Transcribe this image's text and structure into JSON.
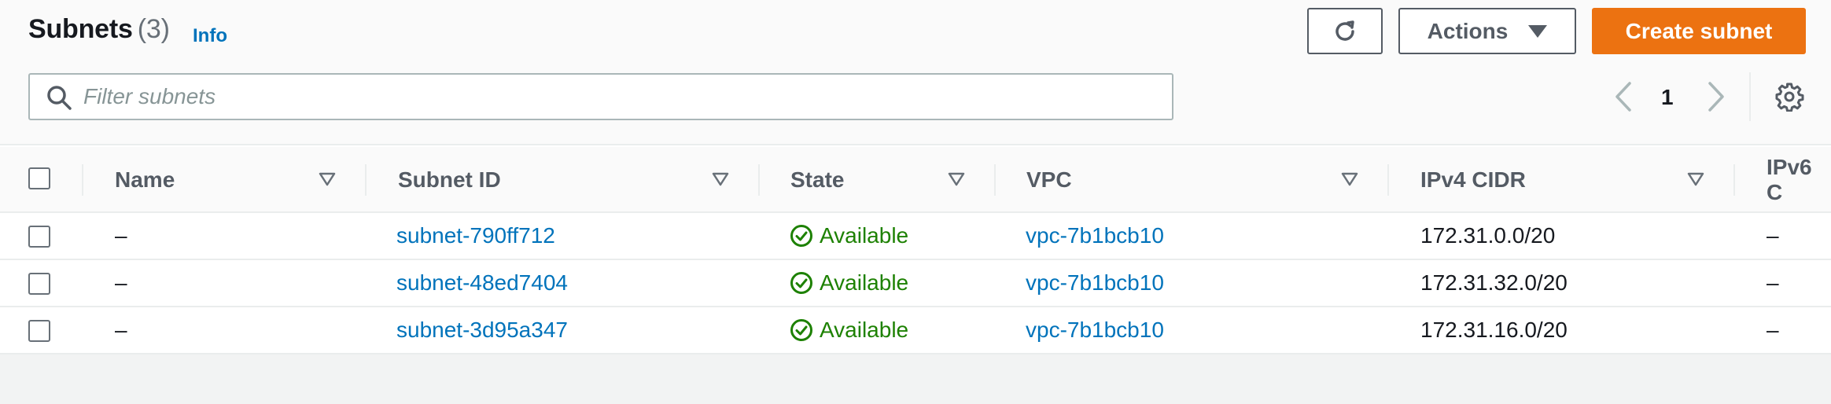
{
  "header": {
    "title": "Subnets",
    "count": "(3)",
    "info_label": "Info",
    "actions_label": "Actions",
    "create_label": "Create subnet"
  },
  "filter": {
    "placeholder": "Filter subnets",
    "value": ""
  },
  "pagination": {
    "current_page": "1"
  },
  "icons": {
    "refresh": "refresh-icon",
    "search": "search-icon",
    "prev": "chevron-left-icon",
    "next": "chevron-right-icon",
    "settings": "gear-icon",
    "status_ok": "check-circle-icon",
    "sort": "sort-caret-icon"
  },
  "colors": {
    "primary": "#ec7211",
    "link": "#0073bb",
    "success": "#1d8102",
    "text": "#16191f"
  },
  "table": {
    "columns": [
      "Name",
      "Subnet ID",
      "State",
      "VPC",
      "IPv4 CIDR",
      "IPv6 C"
    ],
    "rows": [
      {
        "name": "–",
        "subnet_id": "subnet-790ff712",
        "state": "Available",
        "vpc": "vpc-7b1bcb10",
        "ipv4_cidr": "172.31.0.0/20",
        "ipv6_cidr": "–"
      },
      {
        "name": "–",
        "subnet_id": "subnet-48ed7404",
        "state": "Available",
        "vpc": "vpc-7b1bcb10",
        "ipv4_cidr": "172.31.32.0/20",
        "ipv6_cidr": "–"
      },
      {
        "name": "–",
        "subnet_id": "subnet-3d95a347",
        "state": "Available",
        "vpc": "vpc-7b1bcb10",
        "ipv4_cidr": "172.31.16.0/20",
        "ipv6_cidr": "–"
      }
    ]
  }
}
